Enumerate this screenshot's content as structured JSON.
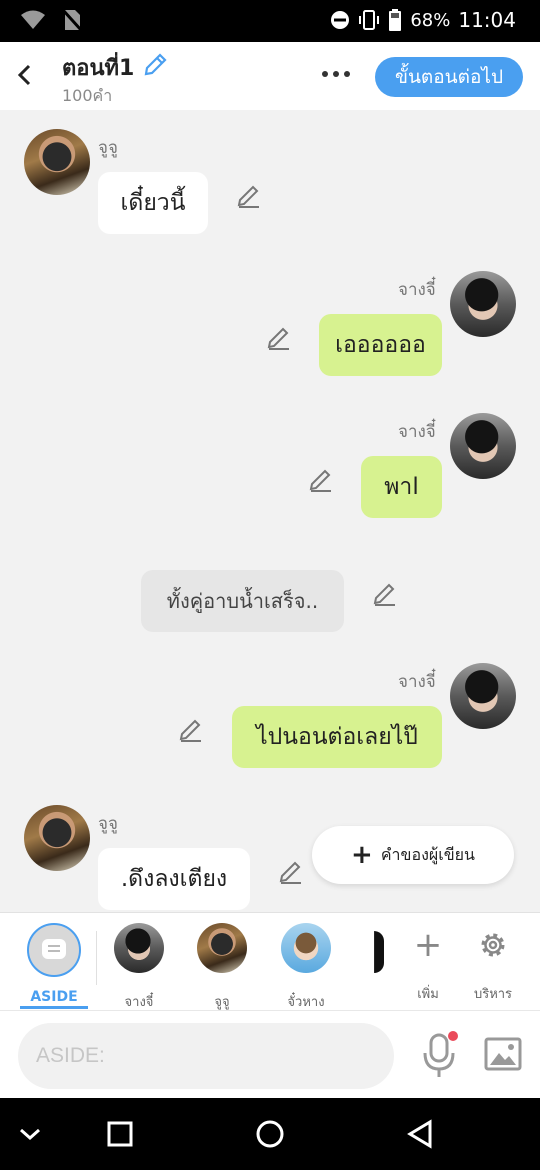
{
  "status_bar": {
    "battery": "68%",
    "time": "11:04",
    "icons": [
      "wifi-icon",
      "no-sim-icon",
      "do-not-disturb-icon",
      "vibrate-icon",
      "battery-icon"
    ]
  },
  "header": {
    "title": "ตอนที่1",
    "word_count": "100คำ",
    "next_button": "ขั้นตอนต่อไป",
    "icons": [
      "back-arrow-icon",
      "edit-pencil-icon",
      "more-dots-icon"
    ]
  },
  "messages": [
    {
      "speaker": "จูจู",
      "text": "เดี๋ยวนี้",
      "side": "left",
      "color": "#ffffff"
    },
    {
      "speaker": "จางจี๋",
      "text": "เออออออ",
      "side": "right",
      "color": "#d7f290"
    },
    {
      "speaker": "จางจี๋",
      "text": "พาl",
      "side": "right",
      "color": "#d7f290"
    },
    {
      "speaker": "",
      "text": "ทั้งคู่อาบน้ำเสร็จ..",
      "side": "center",
      "color": "#e6e6e6"
    },
    {
      "speaker": "จางจี๋",
      "text": "ไปนอนต่อเลยไป๊",
      "side": "right",
      "color": "#d7f290"
    },
    {
      "speaker": "จูจู",
      "text": ".ดึงลงเตียง",
      "side": "left",
      "color": "#ffffff"
    }
  ],
  "fab": {
    "label": "คำของผู้เขียน"
  },
  "character_bar": {
    "aside_label": "ASIDE",
    "characters": [
      {
        "name": "จางจี๋"
      },
      {
        "name": "จูจู"
      },
      {
        "name": "จั๋วหาง"
      }
    ],
    "add_label": "เพิ่ม",
    "manage_label": "บริหาร"
  },
  "input": {
    "placeholder": "ASIDE:",
    "value": ""
  },
  "colors": {
    "accent": "#4a9ff0",
    "green_bubble": "#d7f290",
    "background": "#f2f2f2",
    "record_dot": "#ea4a5a"
  }
}
